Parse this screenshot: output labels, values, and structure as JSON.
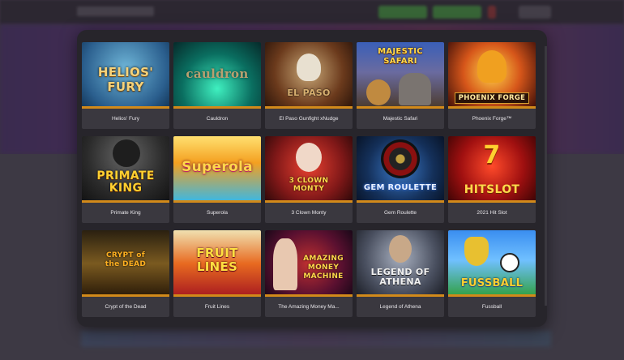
{
  "games": [
    {
      "title": "Helios' Fury",
      "art": "HELIOS' FURY"
    },
    {
      "title": "Cauldron",
      "art": "cauldron"
    },
    {
      "title": "El Paso Gunfight xNudge",
      "art": "EL PASO"
    },
    {
      "title": "Majestic Safari",
      "art": "MAJESTIC SAFARI"
    },
    {
      "title": "Phoenix Forge™",
      "art": "PHOENIX FORGE"
    },
    {
      "title": "Primate King",
      "art": "PRIMATE KING"
    },
    {
      "title": "Superola",
      "art": "Superola"
    },
    {
      "title": "3 Clown Monty",
      "art": "3 CLOWN MONTY"
    },
    {
      "title": "Gem Roulette",
      "art": "GEM ROULETTE"
    },
    {
      "title": "2021 Hit Slot",
      "art": "HITSLOT"
    },
    {
      "title": "Crypt of the Dead",
      "art": "CRYPT of the DEAD"
    },
    {
      "title": "Fruit Lines",
      "art": "FRUIT LINES"
    },
    {
      "title": "The Amazing Money Ma...",
      "art": "AMAZING MONEY MACHINE"
    },
    {
      "title": "Legend of Athena",
      "art": "LEGEND OF ATHENA"
    },
    {
      "title": "Fussball",
      "art": "FUSSBALL"
    }
  ]
}
